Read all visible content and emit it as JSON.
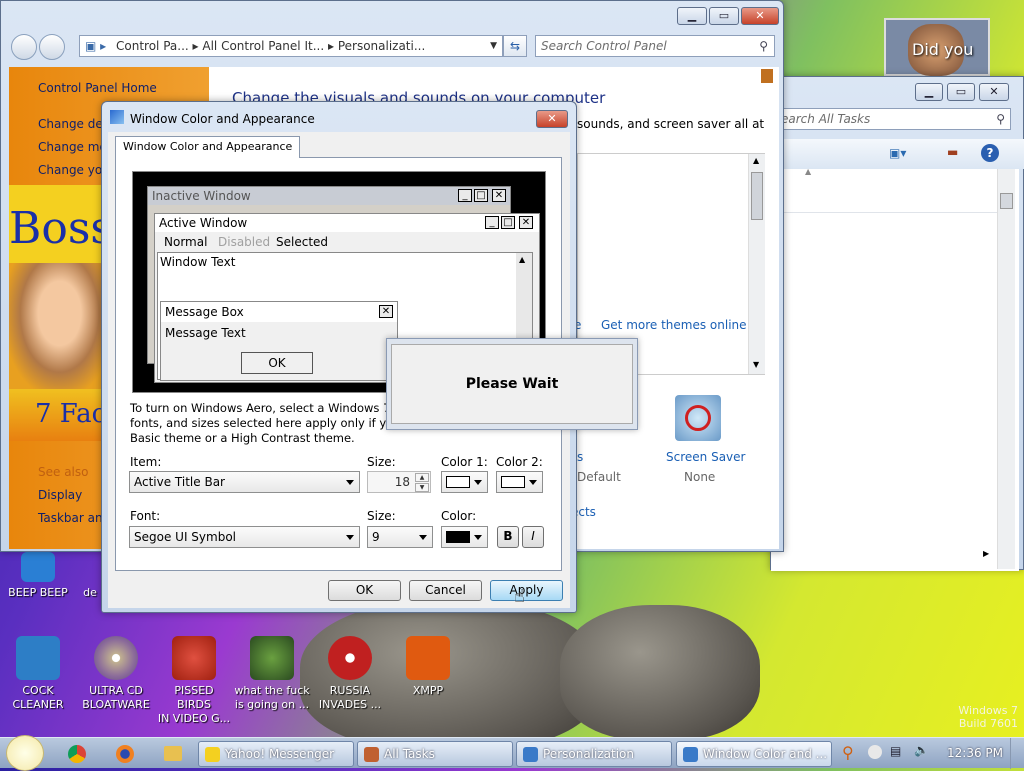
{
  "desktop": {
    "icons": [
      {
        "label": "BEEP BEEP",
        "color": "#2a7fd4"
      },
      {
        "label": "de",
        "color": "#3b6bb5"
      },
      {
        "label": "COCK\nCLEANER",
        "color": "#2d7ec6"
      },
      {
        "label": "ULTRA CD\nBLOATWARE",
        "color": "#c0b090"
      },
      {
        "label": "PISSED BIRDS\nIN VIDEO G...",
        "color": "#c83a2a"
      },
      {
        "label": "what the fuck\nis going on ...",
        "color": "#3a7a2a"
      },
      {
        "label": "RUSSIA\nINVADES ...",
        "color": "#c02020"
      },
      {
        "label": "XMPP",
        "color": "#e05a10"
      }
    ],
    "watermark_line1": "Windows 7",
    "watermark_line2": "Build 7601",
    "gadget_text": "Did you"
  },
  "taskbar": {
    "buttons": [
      {
        "label": "Yahoo! Messenger",
        "icon": "yahoo-messenger-icon"
      },
      {
        "label": "All Tasks",
        "icon": "all-tasks-icon"
      },
      {
        "label": "Personalization",
        "icon": "personalization-icon"
      },
      {
        "label": "Window Color and ...",
        "icon": "window-color-icon"
      }
    ],
    "clock": "12:36 PM"
  },
  "control_panel": {
    "breadcrumb": [
      "Control Pa...",
      "All Control Panel It...",
      "Personalizati..."
    ],
    "search_placeholder": "Search Control Panel",
    "sidebar_home": "Control Panel Home",
    "sidebar_links": [
      "Change des",
      "Change mo",
      "Change you"
    ],
    "sidebar_see_also": "See also",
    "sidebar_bottom": [
      "Display",
      "Taskbar and"
    ],
    "heading": "Change the visuals and sounds on your computer",
    "subtext": "sounds, and screen saver all at",
    "get_more_themes": "Get more themes online",
    "screen_saver_label": "Screen Saver",
    "screen_saver_value": "None",
    "sounds_short": "s",
    "sounds_value": "Default",
    "ects": "ects",
    "banner_boss": "Bossl",
    "banner_seven": "7 Fac",
    "stray_e": "e"
  },
  "all_tasks": {
    "search_placeholder": "earch All Tasks"
  },
  "dialog": {
    "title": "Window Color and Appearance",
    "tab": "Window Color and Appearance",
    "preview": {
      "inactive_title": "Inactive Window",
      "active_title": "Active Window",
      "menu_normal": "Normal",
      "menu_disabled": "Disabled",
      "menu_selected": "Selected",
      "window_text": "Window Text",
      "msgbox_title": "Message Box",
      "msgbox_text": "Message Text",
      "msgbox_ok": "OK"
    },
    "info_line1": "To turn on Windows Aero, select a Windows 7 th",
    "info_line2": "fonts, and sizes selected here apply only if you ha",
    "info_line3": "Basic theme or a High Contrast theme.",
    "item_label": "Item:",
    "item_value": "Active Title Bar",
    "size_label": "Size:",
    "size_value": "18",
    "color1_label": "Color 1:",
    "color2_label": "Color 2:",
    "font_label": "Font:",
    "font_value": "Segoe UI Symbol",
    "font_size_label": "Size:",
    "font_size_value": "9",
    "color_label": "Color:",
    "bold": "B",
    "italic": "I",
    "ok": "OK",
    "cancel": "Cancel",
    "apply": "Apply"
  },
  "please_wait": "Please Wait",
  "colors": {
    "accent": "#1a5fb4",
    "titlebar_active": "#0a246a",
    "preview_bg": "#000000"
  }
}
